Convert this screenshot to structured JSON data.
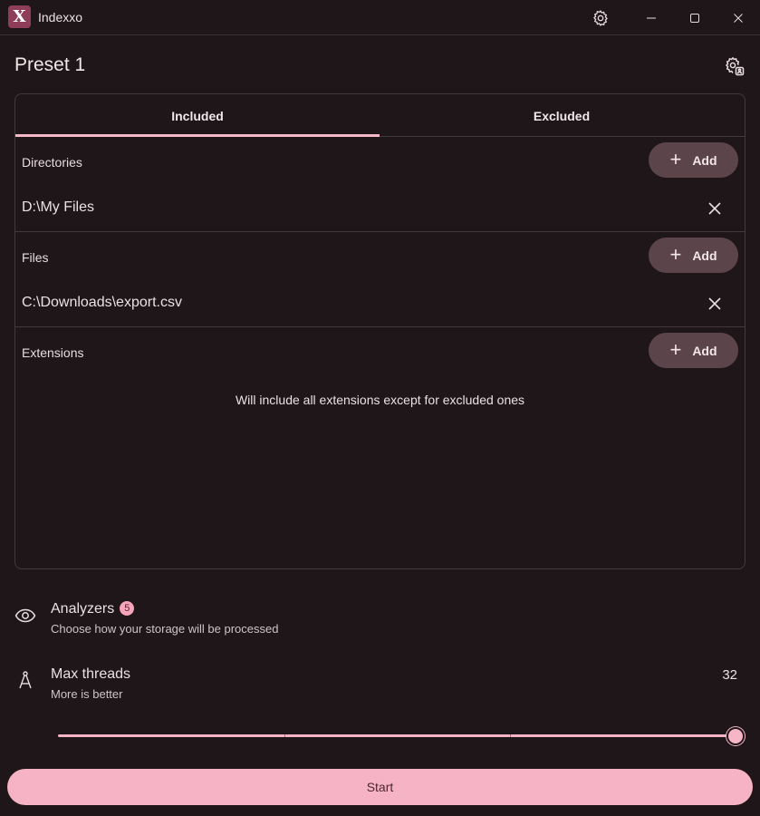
{
  "app": {
    "title": "Indexxo",
    "logo_letter": "X",
    "accent": "#f6b6c7",
    "background": "#1f1619",
    "logo_color": "#8f3e59"
  },
  "titlebar": {
    "icons": [
      "gear-icon",
      "minimize-icon",
      "maximize-icon",
      "close-icon"
    ]
  },
  "preset": {
    "title": "Preset 1",
    "settings_icon": "preset-settings-icon"
  },
  "tabs": [
    {
      "label": "Included",
      "selected": true
    },
    {
      "label": "Excluded",
      "selected": false
    }
  ],
  "sections": {
    "directories": {
      "label": "Directories",
      "add_label": "Add",
      "items": [
        "D:\\My Files"
      ]
    },
    "files": {
      "label": "Files",
      "add_label": "Add",
      "items": [
        "C:\\Downloads\\export.csv"
      ]
    },
    "extensions": {
      "label": "Extensions",
      "add_label": "Add",
      "note": "Will include all extensions except for excluded ones"
    }
  },
  "analyzers": {
    "title": "Analyzers",
    "badge": "5",
    "description": "Choose how your storage will be processed",
    "icon": "eye-icon"
  },
  "threads": {
    "title": "Max threads",
    "description": "More is better",
    "value": "32",
    "icon": "compass-icon",
    "slider_fraction": 1.0
  },
  "start_label": "Start"
}
